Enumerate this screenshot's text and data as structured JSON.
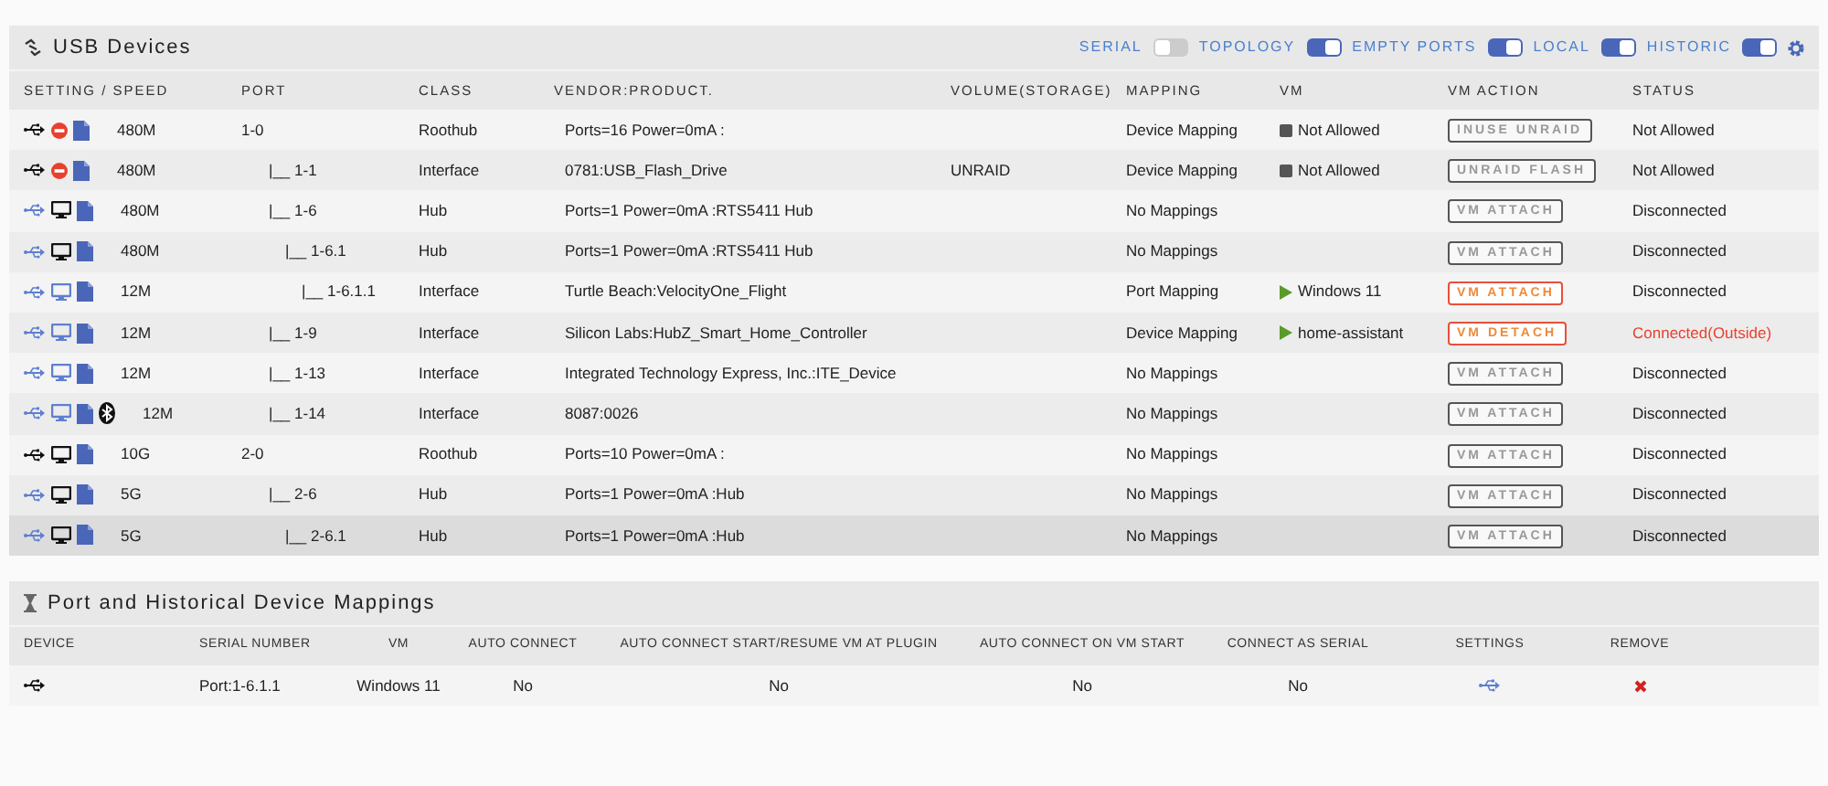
{
  "usb_panel": {
    "title": "USB Devices",
    "toggles": [
      {
        "label": "SERIAL",
        "on": false
      },
      {
        "label": "TOPOLOGY",
        "on": true
      },
      {
        "label": "EMPTY PORTS",
        "on": true
      },
      {
        "label": "LOCAL",
        "on": true
      },
      {
        "label": "HISTORIC",
        "on": true
      }
    ],
    "columns": [
      "SETTING / SPEED",
      "PORT",
      "CLASS",
      "VENDOR:PRODUCT.",
      "VOLUME(STORAGE)",
      "MAPPING",
      "VM",
      "VM ACTION",
      "STATUS"
    ],
    "rows": [
      {
        "usb_highlighted": false,
        "blocked": true,
        "bluetooth": false,
        "speed": "480M",
        "port": "1-0",
        "class": "Roothub",
        "product": "Ports=16 Power=0mA :",
        "mapping": "Device Mapping",
        "vm": {
          "name": "Not Allowed",
          "running": false
        },
        "action": {
          "label": "INUSE UNRAID",
          "highlight": false
        },
        "status": "Not Allowed",
        "alert": false,
        "selected": false,
        "children": [
          {
            "usb_highlighted": false,
            "blocked": true,
            "bluetooth": false,
            "speed": "480M",
            "port": "|__ 1-1",
            "class": "Interface",
            "product": "0781:USB_Flash_Drive",
            "volume": "UNRAID",
            "mapping": "Device Mapping",
            "vm": {
              "name": "Not Allowed",
              "running": false
            },
            "action": {
              "label": "UNRAID FLASH",
              "highlight": false
            },
            "status": "Not Allowed",
            "alert": false,
            "selected": false
          },
          {
            "usb_highlighted": true,
            "blocked": false,
            "monitor_highlighted": false,
            "bluetooth": false,
            "speed": "480M",
            "port": "|__ 1-6",
            "class": "Hub",
            "product": "Ports=1 Power=0mA :RTS5411 Hub",
            "mapping": "No Mappings",
            "action": {
              "label": "VM ATTACH",
              "highlight": false
            },
            "status": "Disconnected",
            "alert": false,
            "selected": false,
            "children": [
              {
                "usb_highlighted": true,
                "blocked": false,
                "monitor_highlighted": false,
                "bluetooth": false,
                "speed": "480M",
                "port": "|__ 1-6.1",
                "class": "Hub",
                "product": "Ports=1 Power=0mA :RTS5411 Hub",
                "mapping": "No Mappings",
                "action": {
                  "label": "VM ATTACH",
                  "highlight": false
                },
                "status": "Disconnected",
                "alert": false,
                "selected": false,
                "children": [
                  {
                    "usb_highlighted": true,
                    "blocked": false,
                    "monitor_highlighted": true,
                    "bluetooth": false,
                    "speed": "12M",
                    "port": "|__ 1-6.1.1",
                    "class": "Interface",
                    "product": "Turtle Beach:VelocityOne_Flight",
                    "mapping": "Port Mapping",
                    "vm": {
                      "name": "Windows 11",
                      "running": true
                    },
                    "action": {
                      "label": "VM ATTACH",
                      "highlight": true
                    },
                    "status": "Disconnected",
                    "alert": false,
                    "selected": false
                  }
                ]
              }
            ]
          },
          {
            "usb_highlighted": true,
            "blocked": false,
            "monitor_highlighted": true,
            "bluetooth": false,
            "speed": "12M",
            "port": "|__ 1-9",
            "class": "Interface",
            "product": "Silicon Labs:HubZ_Smart_Home_Controller",
            "mapping": "Device Mapping",
            "vm": {
              "name": "home-assistant",
              "running": true
            },
            "action": {
              "label": "VM DETACH",
              "highlight": true
            },
            "status": "Connected(Outside)",
            "alert": true,
            "selected": false
          },
          {
            "usb_highlighted": true,
            "blocked": false,
            "monitor_highlighted": true,
            "bluetooth": false,
            "speed": "12M",
            "port": "|__ 1-13",
            "class": "Interface",
            "product": "Integrated Technology Express, Inc.:ITE_Device",
            "mapping": "No Mappings",
            "action": {
              "label": "VM ATTACH",
              "highlight": false
            },
            "status": "Disconnected",
            "alert": false,
            "selected": false
          },
          {
            "usb_highlighted": true,
            "blocked": false,
            "monitor_highlighted": true,
            "bluetooth": true,
            "speed": "12M",
            "port": "|__ 1-14",
            "class": "Interface",
            "product": "8087:0026",
            "mapping": "No Mappings",
            "action": {
              "label": "VM ATTACH",
              "highlight": false
            },
            "status": "Disconnected",
            "alert": false,
            "selected": false
          }
        ]
      },
      {
        "usb_highlighted": false,
        "blocked": false,
        "monitor_highlighted": false,
        "bluetooth": false,
        "speed": "10G",
        "port": "2-0",
        "class": "Roothub",
        "product": "Ports=10 Power=0mA :",
        "mapping": "No Mappings",
        "action": {
          "label": "VM ATTACH",
          "highlight": false
        },
        "status": "Disconnected",
        "alert": false,
        "selected": false,
        "children": [
          {
            "usb_highlighted": true,
            "blocked": false,
            "monitor_highlighted": false,
            "bluetooth": false,
            "speed": "5G",
            "port": "|__ 2-6",
            "class": "Hub",
            "product": "Ports=1 Power=0mA :Hub",
            "mapping": "No Mappings",
            "action": {
              "label": "VM ATTACH",
              "highlight": false
            },
            "status": "Disconnected",
            "alert": false,
            "selected": false,
            "children": [
              {
                "usb_highlighted": true,
                "blocked": false,
                "monitor_highlighted": false,
                "bluetooth": false,
                "speed": "5G",
                "port": "|__ 2-6.1",
                "class": "Hub",
                "product": "Ports=1 Power=0mA :Hub",
                "mapping": "No Mappings",
                "action": {
                  "label": "VM ATTACH",
                  "highlight": false
                },
                "status": "Disconnected",
                "alert": false,
                "selected": true
              }
            ]
          }
        ]
      }
    ]
  },
  "mappings_panel": {
    "title": "Port and Historical Device Mappings",
    "columns": [
      "DEVICE",
      "SERIAL NUMBER",
      "VM",
      "AUTO CONNECT",
      "AUTO CONNECT START/RESUME VM AT PLUGIN",
      "AUTO CONNECT ON VM START",
      "CONNECT AS SERIAL",
      "SETTINGS",
      "REMOVE"
    ],
    "rows": [
      {
        "serial": "Port:1-6.1.1",
        "vm": "Windows 11",
        "auto_connect": "No",
        "auto_start": "No",
        "on_vm_start": "No",
        "as_serial": "No"
      }
    ]
  }
}
